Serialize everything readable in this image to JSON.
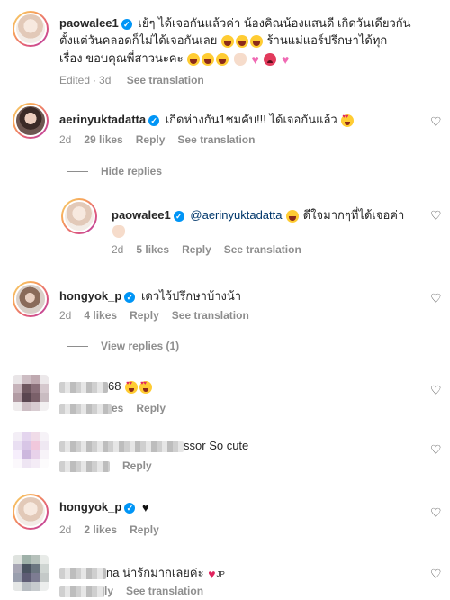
{
  "post": {
    "username": "paowalee1",
    "caption_line1": "เย้ๆ ได้เจอกันแล้วค่า น้องคิณน้องแสนดี เกิดวันเดียวกัน",
    "caption_line2": "ตั้งแต่วันคลอดก็ไม่ได้เจอกันเลย",
    "caption_line2b": "ร้านแม่แอร์ปรึกษาได้ทุก",
    "caption_line3": "เรื่อง ขอบคุณพี่สาวนะคะ",
    "edited": "Edited",
    "dot": "·",
    "age": "3d",
    "see_translation": "See translation"
  },
  "comments": [
    {
      "username": "aerinyuktadatta",
      "text": "เกิดห่างกัน1ชมคับ!!! ได้เจอกันแล้ว",
      "age": "2d",
      "likes": "29 likes",
      "reply": "Reply",
      "see_translation": "See translation",
      "hide_replies": "Hide replies"
    },
    {
      "username": "paowalee1",
      "mention": "@aerinyuktadatta",
      "text": "ดีใจมากๆที่ได้เจอค่า",
      "age": "2d",
      "likes": "5 likes",
      "reply": "Reply",
      "see_translation": "See translation"
    },
    {
      "username": "hongyok_p",
      "text": "เดวไว้ปรึกษาบ้างน้า",
      "age": "2d",
      "likes": "4 likes",
      "reply": "Reply",
      "see_translation": "See translation",
      "view_replies": "View replies (1)"
    },
    {
      "username_tail": "68",
      "likes_tail": "es",
      "reply": "Reply"
    },
    {
      "username_tail": "ssor",
      "text": "So cute",
      "reply": "Reply"
    },
    {
      "username": "hongyok_p",
      "age": "2d",
      "likes": "2 likes",
      "reply": "Reply"
    },
    {
      "username_tail": "na",
      "text": "น่ารักมากเลยค่ะ",
      "flag": "JP",
      "meta_tail": "ly",
      "see_translation": "See translation"
    }
  ],
  "icons": {
    "like": "heart-outline-icon",
    "verified": "verified-badge-icon"
  },
  "colors": {
    "verified": "#0095f6",
    "meta": "#8e8e8e",
    "mention": "#00376b"
  }
}
